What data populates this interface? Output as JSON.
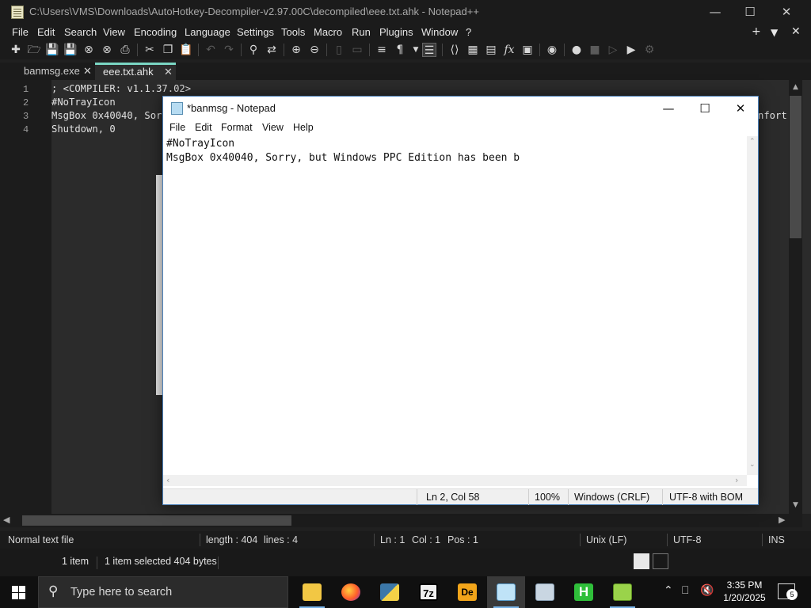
{
  "npp": {
    "title": "C:\\Users\\VMS\\Downloads\\AutoHotkey-Decompiler-v2.97.00C\\decompiled\\eee.txt.ahk - Notepad++",
    "menu": [
      "File",
      "Edit",
      "Search",
      "View",
      "Encoding",
      "Language",
      "Settings",
      "Tools",
      "Macro",
      "Run",
      "Plugins",
      "Window",
      "?"
    ],
    "menu_right": [
      "+",
      "▼",
      "✕"
    ],
    "tabs": [
      {
        "label": "banmsg.exe",
        "active": false
      },
      {
        "label": "eee.txt.ahk",
        "active": true
      }
    ],
    "lines": [
      {
        "no": "1",
        "text": "; <COMPILER: v1.1.37.02>"
      },
      {
        "no": "2",
        "text": "#NoTrayIcon"
      },
      {
        "no": "3",
        "text": "MsgBox 0x40040, Sor"
      },
      {
        "no": "4",
        "text": "Shutdown, 0"
      }
    ],
    "line3_tail": "nfort",
    "status": {
      "filetype": "Normal text file",
      "length": "length : 404",
      "lines": "lines : 4",
      "ln": "Ln : 1",
      "col": "Col : 1",
      "pos": "Pos : 1",
      "eol": "Unix (LF)",
      "encoding": "UTF-8",
      "mode": "INS"
    }
  },
  "explorer": {
    "items": "1 item",
    "selected": "1 item selected  404 bytes"
  },
  "notepad": {
    "title": "*banmsg - Notepad",
    "menu": [
      "File",
      "Edit",
      "Format",
      "View",
      "Help"
    ],
    "lines": [
      "#NoTrayIcon",
      "MsgBox 0x40040, Sorry, but Windows PPC Edition has been b"
    ],
    "status": {
      "position": "Ln 2, Col 58",
      "zoom": "100%",
      "eol": "Windows (CRLF)",
      "encoding": "UTF-8 with BOM"
    }
  },
  "taskbar": {
    "search_placeholder": "Type here to search",
    "time": "3:35 PM",
    "date": "1/20/2025",
    "notification_count": "5",
    "apps": [
      "file-explorer",
      "firefox",
      "python",
      "7zip",
      "decompiler",
      "notepad",
      "system-config",
      "hex-editor",
      "notepad-plus-plus"
    ]
  },
  "colors": {
    "accent_tab": "#7ad6c3",
    "taskbar_active": "#79b4e8"
  }
}
